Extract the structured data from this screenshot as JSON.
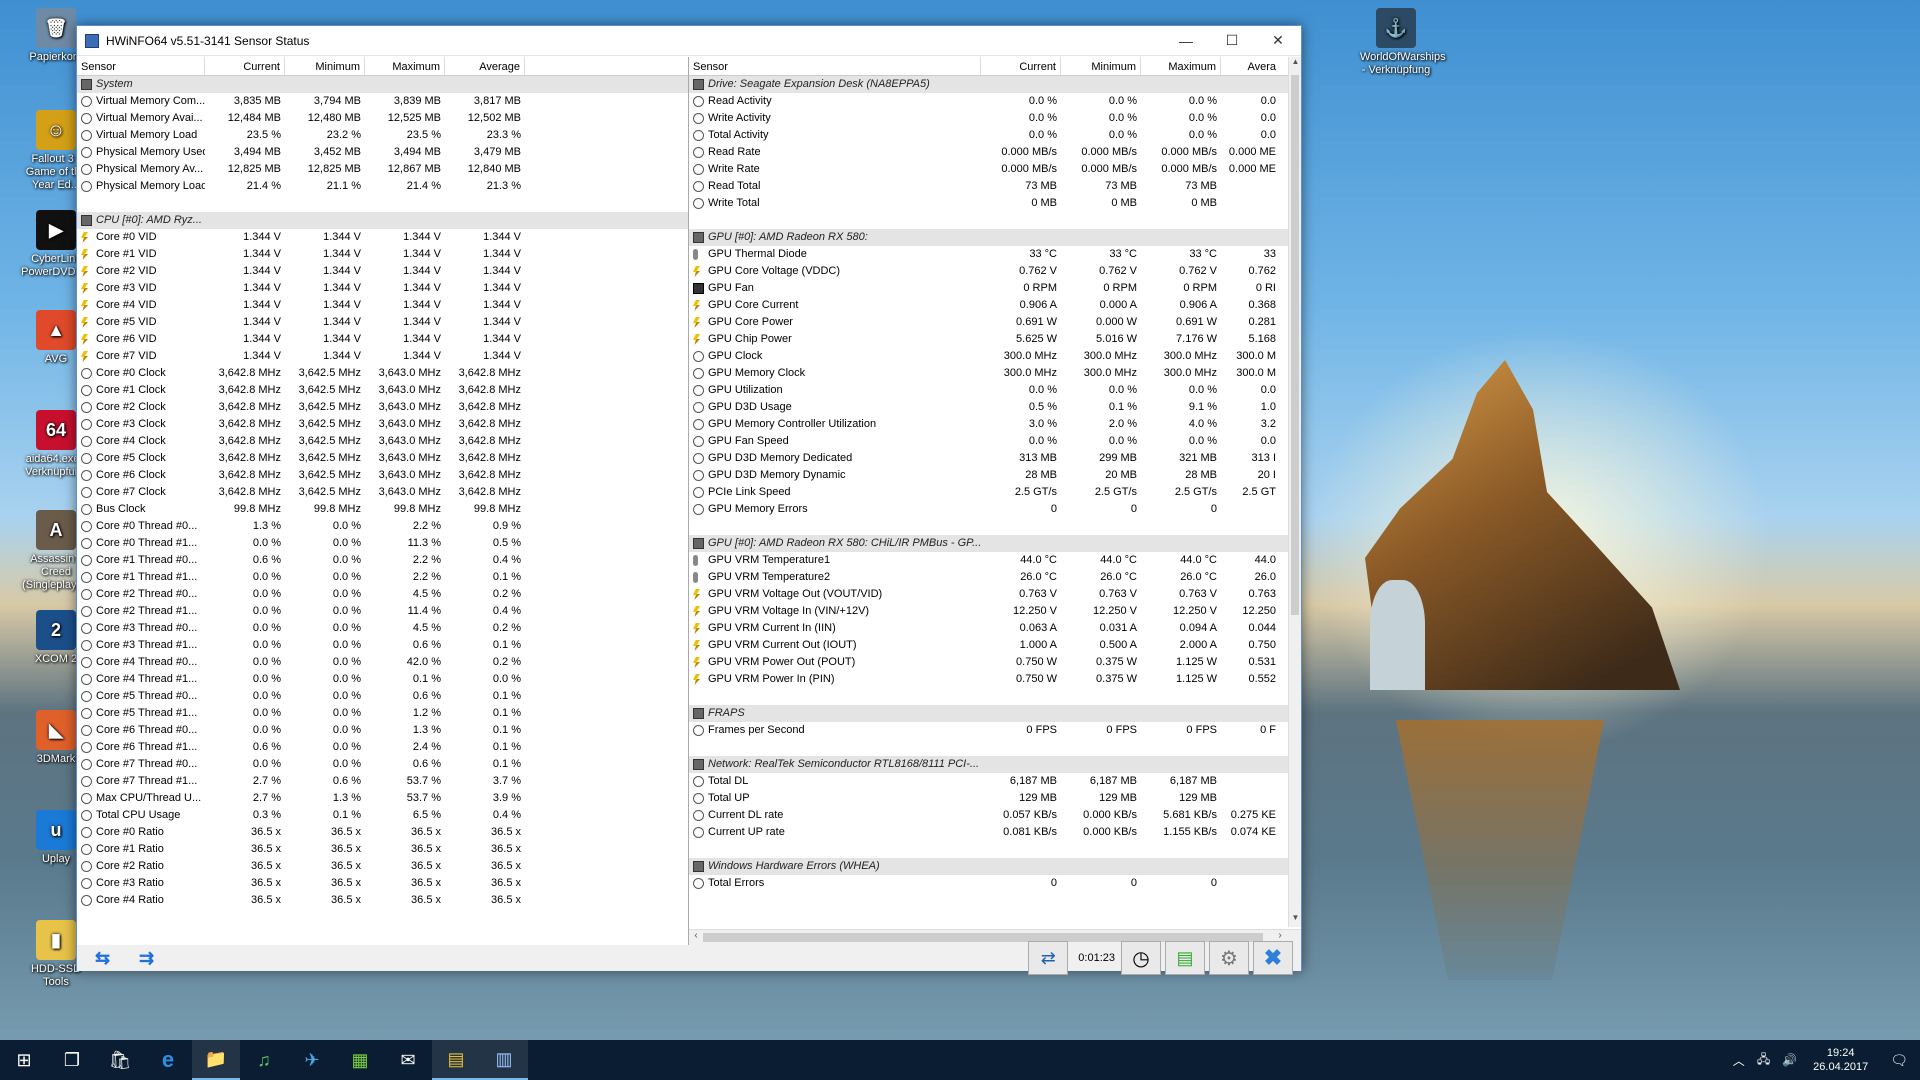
{
  "window": {
    "title": "HWiNFO64 v5.51-3141 Sensor Status",
    "minimize": "—",
    "maximize": "☐",
    "close": "✕"
  },
  "columns": {
    "sensor": "Sensor",
    "current": "Current",
    "minimum": "Minimum",
    "maximum": "Maximum",
    "average": "Average",
    "average_cut": "Avera"
  },
  "left_rows": [
    {
      "t": "group",
      "icon": "group",
      "name": "System"
    },
    {
      "t": "row",
      "icon": "clock",
      "name": "Virtual Memory Com...",
      "cur": "3,835 MB",
      "min": "3,794 MB",
      "max": "3,839 MB",
      "avg": "3,817 MB"
    },
    {
      "t": "row",
      "icon": "clock",
      "name": "Virtual Memory Avai...",
      "cur": "12,484 MB",
      "min": "12,480 MB",
      "max": "12,525 MB",
      "avg": "12,502 MB"
    },
    {
      "t": "row",
      "icon": "clock",
      "name": "Virtual Memory Load",
      "cur": "23.5 %",
      "min": "23.2 %",
      "max": "23.5 %",
      "avg": "23.3 %"
    },
    {
      "t": "row",
      "icon": "clock",
      "name": "Physical Memory Used",
      "cur": "3,494 MB",
      "min": "3,452 MB",
      "max": "3,494 MB",
      "avg": "3,479 MB"
    },
    {
      "t": "row",
      "icon": "clock",
      "name": "Physical Memory Av...",
      "cur": "12,825 MB",
      "min": "12,825 MB",
      "max": "12,867 MB",
      "avg": "12,840 MB"
    },
    {
      "t": "row",
      "icon": "clock",
      "name": "Physical Memory Load",
      "cur": "21.4 %",
      "min": "21.1 %",
      "max": "21.4 %",
      "avg": "21.3 %"
    },
    {
      "t": "blank"
    },
    {
      "t": "group",
      "icon": "group",
      "name": "CPU [#0]: AMD Ryz..."
    },
    {
      "t": "row",
      "icon": "volt",
      "name": "Core #0 VID",
      "cur": "1.344 V",
      "min": "1.344 V",
      "max": "1.344 V",
      "avg": "1.344 V"
    },
    {
      "t": "row",
      "icon": "volt",
      "name": "Core #1 VID",
      "cur": "1.344 V",
      "min": "1.344 V",
      "max": "1.344 V",
      "avg": "1.344 V"
    },
    {
      "t": "row",
      "icon": "volt",
      "name": "Core #2 VID",
      "cur": "1.344 V",
      "min": "1.344 V",
      "max": "1.344 V",
      "avg": "1.344 V"
    },
    {
      "t": "row",
      "icon": "volt",
      "name": "Core #3 VID",
      "cur": "1.344 V",
      "min": "1.344 V",
      "max": "1.344 V",
      "avg": "1.344 V"
    },
    {
      "t": "row",
      "icon": "volt",
      "name": "Core #4 VID",
      "cur": "1.344 V",
      "min": "1.344 V",
      "max": "1.344 V",
      "avg": "1.344 V"
    },
    {
      "t": "row",
      "icon": "volt",
      "name": "Core #5 VID",
      "cur": "1.344 V",
      "min": "1.344 V",
      "max": "1.344 V",
      "avg": "1.344 V"
    },
    {
      "t": "row",
      "icon": "volt",
      "name": "Core #6 VID",
      "cur": "1.344 V",
      "min": "1.344 V",
      "max": "1.344 V",
      "avg": "1.344 V"
    },
    {
      "t": "row",
      "icon": "volt",
      "name": "Core #7 VID",
      "cur": "1.344 V",
      "min": "1.344 V",
      "max": "1.344 V",
      "avg": "1.344 V"
    },
    {
      "t": "row",
      "icon": "clock",
      "name": "Core #0 Clock",
      "cur": "3,642.8 MHz",
      "min": "3,642.5 MHz",
      "max": "3,643.0 MHz",
      "avg": "3,642.8 MHz"
    },
    {
      "t": "row",
      "icon": "clock",
      "name": "Core #1 Clock",
      "cur": "3,642.8 MHz",
      "min": "3,642.5 MHz",
      "max": "3,643.0 MHz",
      "avg": "3,642.8 MHz"
    },
    {
      "t": "row",
      "icon": "clock",
      "name": "Core #2 Clock",
      "cur": "3,642.8 MHz",
      "min": "3,642.5 MHz",
      "max": "3,643.0 MHz",
      "avg": "3,642.8 MHz"
    },
    {
      "t": "row",
      "icon": "clock",
      "name": "Core #3 Clock",
      "cur": "3,642.8 MHz",
      "min": "3,642.5 MHz",
      "max": "3,643.0 MHz",
      "avg": "3,642.8 MHz"
    },
    {
      "t": "row",
      "icon": "clock",
      "name": "Core #4 Clock",
      "cur": "3,642.8 MHz",
      "min": "3,642.5 MHz",
      "max": "3,643.0 MHz",
      "avg": "3,642.8 MHz"
    },
    {
      "t": "row",
      "icon": "clock",
      "name": "Core #5 Clock",
      "cur": "3,642.8 MHz",
      "min": "3,642.5 MHz",
      "max": "3,643.0 MHz",
      "avg": "3,642.8 MHz"
    },
    {
      "t": "row",
      "icon": "clock",
      "name": "Core #6 Clock",
      "cur": "3,642.8 MHz",
      "min": "3,642.5 MHz",
      "max": "3,643.0 MHz",
      "avg": "3,642.8 MHz"
    },
    {
      "t": "row",
      "icon": "clock",
      "name": "Core #7 Clock",
      "cur": "3,642.8 MHz",
      "min": "3,642.5 MHz",
      "max": "3,643.0 MHz",
      "avg": "3,642.8 MHz"
    },
    {
      "t": "row",
      "icon": "clock",
      "name": "Bus Clock",
      "cur": "99.8 MHz",
      "min": "99.8 MHz",
      "max": "99.8 MHz",
      "avg": "99.8 MHz"
    },
    {
      "t": "row",
      "icon": "clock",
      "name": "Core #0 Thread #0...",
      "cur": "1.3 %",
      "min": "0.0 %",
      "max": "2.2 %",
      "avg": "0.9 %"
    },
    {
      "t": "row",
      "icon": "clock",
      "name": "Core #0 Thread #1...",
      "cur": "0.0 %",
      "min": "0.0 %",
      "max": "11.3 %",
      "avg": "0.5 %"
    },
    {
      "t": "row",
      "icon": "clock",
      "name": "Core #1 Thread #0...",
      "cur": "0.6 %",
      "min": "0.0 %",
      "max": "2.2 %",
      "avg": "0.4 %"
    },
    {
      "t": "row",
      "icon": "clock",
      "name": "Core #1 Thread #1...",
      "cur": "0.0 %",
      "min": "0.0 %",
      "max": "2.2 %",
      "avg": "0.1 %"
    },
    {
      "t": "row",
      "icon": "clock",
      "name": "Core #2 Thread #0...",
      "cur": "0.0 %",
      "min": "0.0 %",
      "max": "4.5 %",
      "avg": "0.2 %"
    },
    {
      "t": "row",
      "icon": "clock",
      "name": "Core #2 Thread #1...",
      "cur": "0.0 %",
      "min": "0.0 %",
      "max": "11.4 %",
      "avg": "0.4 %"
    },
    {
      "t": "row",
      "icon": "clock",
      "name": "Core #3 Thread #0...",
      "cur": "0.0 %",
      "min": "0.0 %",
      "max": "4.5 %",
      "avg": "0.2 %"
    },
    {
      "t": "row",
      "icon": "clock",
      "name": "Core #3 Thread #1...",
      "cur": "0.0 %",
      "min": "0.0 %",
      "max": "0.6 %",
      "avg": "0.1 %"
    },
    {
      "t": "row",
      "icon": "clock",
      "name": "Core #4 Thread #0...",
      "cur": "0.0 %",
      "min": "0.0 %",
      "max": "42.0 %",
      "avg": "0.2 %"
    },
    {
      "t": "row",
      "icon": "clock",
      "name": "Core #4 Thread #1...",
      "cur": "0.0 %",
      "min": "0.0 %",
      "max": "0.1 %",
      "avg": "0.0 %"
    },
    {
      "t": "row",
      "icon": "clock",
      "name": "Core #5 Thread #0...",
      "cur": "0.0 %",
      "min": "0.0 %",
      "max": "0.6 %",
      "avg": "0.1 %"
    },
    {
      "t": "row",
      "icon": "clock",
      "name": "Core #5 Thread #1...",
      "cur": "0.0 %",
      "min": "0.0 %",
      "max": "1.2 %",
      "avg": "0.1 %"
    },
    {
      "t": "row",
      "icon": "clock",
      "name": "Core #6 Thread #0...",
      "cur": "0.0 %",
      "min": "0.0 %",
      "max": "1.3 %",
      "avg": "0.1 %"
    },
    {
      "t": "row",
      "icon": "clock",
      "name": "Core #6 Thread #1...",
      "cur": "0.6 %",
      "min": "0.0 %",
      "max": "2.4 %",
      "avg": "0.1 %"
    },
    {
      "t": "row",
      "icon": "clock",
      "name": "Core #7 Thread #0...",
      "cur": "0.0 %",
      "min": "0.0 %",
      "max": "0.6 %",
      "avg": "0.1 %"
    },
    {
      "t": "row",
      "icon": "clock",
      "name": "Core #7 Thread #1...",
      "cur": "2.7 %",
      "min": "0.6 %",
      "max": "53.7 %",
      "avg": "3.7 %"
    },
    {
      "t": "row",
      "icon": "clock",
      "name": "Max CPU/Thread U...",
      "cur": "2.7 %",
      "min": "1.3 %",
      "max": "53.7 %",
      "avg": "3.9 %"
    },
    {
      "t": "row",
      "icon": "clock",
      "name": "Total CPU Usage",
      "cur": "0.3 %",
      "min": "0.1 %",
      "max": "6.5 %",
      "avg": "0.4 %"
    },
    {
      "t": "row",
      "icon": "clock",
      "name": "Core #0 Ratio",
      "cur": "36.5 x",
      "min": "36.5 x",
      "max": "36.5 x",
      "avg": "36.5 x"
    },
    {
      "t": "row",
      "icon": "clock",
      "name": "Core #1 Ratio",
      "cur": "36.5 x",
      "min": "36.5 x",
      "max": "36.5 x",
      "avg": "36.5 x"
    },
    {
      "t": "row",
      "icon": "clock",
      "name": "Core #2 Ratio",
      "cur": "36.5 x",
      "min": "36.5 x",
      "max": "36.5 x",
      "avg": "36.5 x"
    },
    {
      "t": "row",
      "icon": "clock",
      "name": "Core #3 Ratio",
      "cur": "36.5 x",
      "min": "36.5 x",
      "max": "36.5 x",
      "avg": "36.5 x"
    },
    {
      "t": "row",
      "icon": "clock",
      "name": "Core #4 Ratio",
      "cur": "36.5 x",
      "min": "36.5 x",
      "max": "36.5 x",
      "avg": "36.5 x"
    }
  ],
  "right_rows": [
    {
      "t": "group",
      "icon": "group",
      "name": "Drive: Seagate Expansion Desk (NA8EPPA5)"
    },
    {
      "t": "row",
      "icon": "clock",
      "name": "Read Activity",
      "cur": "0.0 %",
      "min": "0.0 %",
      "max": "0.0 %",
      "avg": "0.0"
    },
    {
      "t": "row",
      "icon": "clock",
      "name": "Write Activity",
      "cur": "0.0 %",
      "min": "0.0 %",
      "max": "0.0 %",
      "avg": "0.0"
    },
    {
      "t": "row",
      "icon": "clock",
      "name": "Total Activity",
      "cur": "0.0 %",
      "min": "0.0 %",
      "max": "0.0 %",
      "avg": "0.0"
    },
    {
      "t": "row",
      "icon": "clock",
      "name": "Read Rate",
      "cur": "0.000 MB/s",
      "min": "0.000 MB/s",
      "max": "0.000 MB/s",
      "avg": "0.000 ME"
    },
    {
      "t": "row",
      "icon": "clock",
      "name": "Write Rate",
      "cur": "0.000 MB/s",
      "min": "0.000 MB/s",
      "max": "0.000 MB/s",
      "avg": "0.000 ME"
    },
    {
      "t": "row",
      "icon": "clock",
      "name": "Read Total",
      "cur": "73 MB",
      "min": "73 MB",
      "max": "73 MB",
      "avg": ""
    },
    {
      "t": "row",
      "icon": "clock",
      "name": "Write Total",
      "cur": "0 MB",
      "min": "0 MB",
      "max": "0 MB",
      "avg": ""
    },
    {
      "t": "blank"
    },
    {
      "t": "group",
      "icon": "group",
      "name": "GPU [#0]: AMD Radeon RX 580:"
    },
    {
      "t": "row",
      "icon": "therm",
      "name": "GPU Thermal Diode",
      "cur": "33 °C",
      "min": "33 °C",
      "max": "33 °C",
      "avg": "33"
    },
    {
      "t": "row",
      "icon": "volt",
      "name": "GPU Core Voltage (VDDC)",
      "cur": "0.762 V",
      "min": "0.762 V",
      "max": "0.762 V",
      "avg": "0.762"
    },
    {
      "t": "row",
      "icon": "fan",
      "name": "GPU Fan",
      "cur": "0 RPM",
      "min": "0 RPM",
      "max": "0 RPM",
      "avg": "0 RI"
    },
    {
      "t": "row",
      "icon": "volt",
      "name": "GPU Core Current",
      "cur": "0.906 A",
      "min": "0.000 A",
      "max": "0.906 A",
      "avg": "0.368"
    },
    {
      "t": "row",
      "icon": "volt",
      "name": "GPU Core Power",
      "cur": "0.691 W",
      "min": "0.000 W",
      "max": "0.691 W",
      "avg": "0.281"
    },
    {
      "t": "row",
      "icon": "volt",
      "name": "GPU Chip Power",
      "cur": "5.625 W",
      "min": "5.016 W",
      "max": "7.176 W",
      "avg": "5.168"
    },
    {
      "t": "row",
      "icon": "clock",
      "name": "GPU Clock",
      "cur": "300.0 MHz",
      "min": "300.0 MHz",
      "max": "300.0 MHz",
      "avg": "300.0 M"
    },
    {
      "t": "row",
      "icon": "clock",
      "name": "GPU Memory Clock",
      "cur": "300.0 MHz",
      "min": "300.0 MHz",
      "max": "300.0 MHz",
      "avg": "300.0 M"
    },
    {
      "t": "row",
      "icon": "clock",
      "name": "GPU Utilization",
      "cur": "0.0 %",
      "min": "0.0 %",
      "max": "0.0 %",
      "avg": "0.0"
    },
    {
      "t": "row",
      "icon": "clock",
      "name": "GPU D3D Usage",
      "cur": "0.5 %",
      "min": "0.1 %",
      "max": "9.1 %",
      "avg": "1.0"
    },
    {
      "t": "row",
      "icon": "clock",
      "name": "GPU Memory Controller Utilization",
      "cur": "3.0 %",
      "min": "2.0 %",
      "max": "4.0 %",
      "avg": "3.2"
    },
    {
      "t": "row",
      "icon": "clock",
      "name": "GPU Fan Speed",
      "cur": "0.0 %",
      "min": "0.0 %",
      "max": "0.0 %",
      "avg": "0.0"
    },
    {
      "t": "row",
      "icon": "clock",
      "name": "GPU D3D Memory Dedicated",
      "cur": "313 MB",
      "min": "299 MB",
      "max": "321 MB",
      "avg": "313 I"
    },
    {
      "t": "row",
      "icon": "clock",
      "name": "GPU D3D Memory Dynamic",
      "cur": "28 MB",
      "min": "20 MB",
      "max": "28 MB",
      "avg": "20 I"
    },
    {
      "t": "row",
      "icon": "clock",
      "name": "PCIe Link Speed",
      "cur": "2.5 GT/s",
      "min": "2.5 GT/s",
      "max": "2.5 GT/s",
      "avg": "2.5 GT"
    },
    {
      "t": "row",
      "icon": "clock",
      "name": "GPU Memory Errors",
      "cur": "0",
      "min": "0",
      "max": "0",
      "avg": ""
    },
    {
      "t": "blank"
    },
    {
      "t": "group",
      "icon": "group",
      "name": "GPU [#0]: AMD Radeon RX 580: CHiL/IR PMBus - GP..."
    },
    {
      "t": "row",
      "icon": "therm",
      "name": "GPU VRM Temperature1",
      "cur": "44.0 °C",
      "min": "44.0 °C",
      "max": "44.0 °C",
      "avg": "44.0"
    },
    {
      "t": "row",
      "icon": "therm",
      "name": "GPU VRM Temperature2",
      "cur": "26.0 °C",
      "min": "26.0 °C",
      "max": "26.0 °C",
      "avg": "26.0"
    },
    {
      "t": "row",
      "icon": "volt",
      "name": "GPU VRM Voltage Out (VOUT/VID)",
      "cur": "0.763 V",
      "min": "0.763 V",
      "max": "0.763 V",
      "avg": "0.763"
    },
    {
      "t": "row",
      "icon": "volt",
      "name": "GPU VRM Voltage In (VIN/+12V)",
      "cur": "12.250 V",
      "min": "12.250 V",
      "max": "12.250 V",
      "avg": "12.250"
    },
    {
      "t": "row",
      "icon": "volt",
      "name": "GPU VRM Current In (IIN)",
      "cur": "0.063 A",
      "min": "0.031 A",
      "max": "0.094 A",
      "avg": "0.044"
    },
    {
      "t": "row",
      "icon": "volt",
      "name": "GPU VRM Current Out (IOUT)",
      "cur": "1.000 A",
      "min": "0.500 A",
      "max": "2.000 A",
      "avg": "0.750"
    },
    {
      "t": "row",
      "icon": "volt",
      "name": "GPU VRM Power Out (POUT)",
      "cur": "0.750 W",
      "min": "0.375 W",
      "max": "1.125 W",
      "avg": "0.531"
    },
    {
      "t": "row",
      "icon": "volt",
      "name": "GPU VRM Power In (PIN)",
      "cur": "0.750 W",
      "min": "0.375 W",
      "max": "1.125 W",
      "avg": "0.552"
    },
    {
      "t": "blank"
    },
    {
      "t": "group",
      "icon": "group",
      "name": "FRAPS"
    },
    {
      "t": "row",
      "icon": "clock",
      "name": "Frames per Second",
      "cur": "0 FPS",
      "min": "0 FPS",
      "max": "0 FPS",
      "avg": "0 F"
    },
    {
      "t": "blank"
    },
    {
      "t": "group",
      "icon": "group",
      "name": "Network: RealTek Semiconductor RTL8168/8111 PCI-..."
    },
    {
      "t": "row",
      "icon": "clock",
      "name": "Total DL",
      "cur": "6,187 MB",
      "min": "6,187 MB",
      "max": "6,187 MB",
      "avg": ""
    },
    {
      "t": "row",
      "icon": "clock",
      "name": "Total UP",
      "cur": "129 MB",
      "min": "129 MB",
      "max": "129 MB",
      "avg": ""
    },
    {
      "t": "row",
      "icon": "clock",
      "name": "Current DL rate",
      "cur": "0.057 KB/s",
      "min": "0.000 KB/s",
      "max": "5.681 KB/s",
      "avg": "0.275 KE"
    },
    {
      "t": "row",
      "icon": "clock",
      "name": "Current UP rate",
      "cur": "0.081 KB/s",
      "min": "0.000 KB/s",
      "max": "1.155 KB/s",
      "avg": "0.074 KE"
    },
    {
      "t": "blank"
    },
    {
      "t": "group",
      "icon": "group",
      "name": "Windows Hardware Errors (WHEA)"
    },
    {
      "t": "row",
      "icon": "clock",
      "name": "Total Errors",
      "cur": "0",
      "min": "0",
      "max": "0",
      "avg": ""
    }
  ],
  "toolbar": {
    "timer": "0:01:23"
  },
  "desktop_icons": [
    {
      "label": "Papierkorb",
      "icon": "recycle-bin-icon",
      "color": "#6e8aa6",
      "glyph": "🗑"
    },
    {
      "label": "Fallout 3 - Game of the Year Ed...",
      "icon": "fallout-icon",
      "color": "#d4a017",
      "glyph": "☺"
    },
    {
      "label": "CyberLink PowerDVD 16",
      "icon": "powerdvd-icon",
      "color": "#111111",
      "glyph": "▶"
    },
    {
      "label": "AVG",
      "icon": "avg-icon",
      "color": "#e04a2a",
      "glyph": "▲"
    },
    {
      "label": "aida64.exe - Verknüpfung",
      "icon": "aida64-icon",
      "color": "#c8102e",
      "glyph": "64"
    },
    {
      "label": "Assassin's Creed (Singleplayer)",
      "icon": "assassins-creed-icon",
      "color": "#6b5b4a",
      "glyph": "A"
    },
    {
      "label": "XCOM 2",
      "icon": "xcom2-icon",
      "color": "#1b4f8a",
      "glyph": "2"
    },
    {
      "label": "3DMark",
      "icon": "3dmark-icon",
      "color": "#e0602a",
      "glyph": "◣"
    },
    {
      "label": "Uplay",
      "icon": "uplay-icon",
      "color": "#1a7ad6",
      "glyph": "u"
    },
    {
      "label": "HDD-SSD Tools",
      "icon": "hdd-ssd-tools-icon",
      "color": "#e8c34a",
      "glyph": "▮"
    }
  ],
  "desktop_right_icon": {
    "label": "WorldOfWarships - Verknüpfung",
    "icon": "world-of-warships-icon",
    "color": "#2c4a64",
    "glyph": "⚓"
  },
  "taskbar": {
    "start": "⊞",
    "taskview": "❐",
    "store": "🛍",
    "edge": "e",
    "explorer": "📁",
    "spotify": "♫",
    "app6": "✈",
    "calc": "▦",
    "mail": "✉",
    "app9": "▤",
    "hwinfo": "▥",
    "time": "19:24",
    "date": "26.04.2017"
  }
}
